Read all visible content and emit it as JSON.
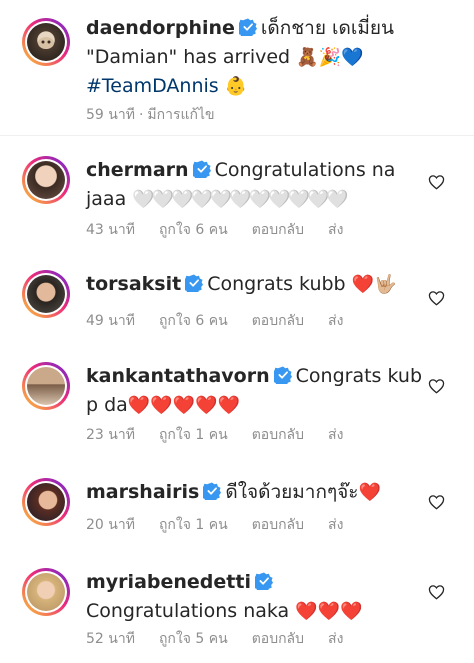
{
  "caption": {
    "username": "daendorphine",
    "text_line1": "เด็กชาย เดเมี่ยน",
    "text_line2": "\"Damian\" has arrived",
    "emoji_line2": "🧸🎉💙",
    "hashtag": "#TeamDAnnis",
    "emoji_line3": "👶",
    "time": "59 นาที",
    "separator": "·",
    "edited": "มีการแก้ไข"
  },
  "labels": {
    "reply": "ตอบกลับ",
    "send": "ส่ง"
  },
  "comments": [
    {
      "username": "chermarn",
      "text": "Congratulations na jaaa",
      "emoji": "🤍🤍🤍🤍🤍🤍🤍🤍🤍🤍🤍",
      "time": "43 นาที",
      "likes": "ถูกใจ 6 คน"
    },
    {
      "username": "torsaksit",
      "text": "Congrats kubb",
      "emoji": "❤️🤟🏼",
      "time": "49 นาที",
      "likes": "ถูกใจ 6 คน"
    },
    {
      "username": "kankantathavorn",
      "text": "Congrats kub p da",
      "emoji": "❤️❤️❤️❤️❤️",
      "time": "23 นาที",
      "likes": "ถูกใจ 1 คน"
    },
    {
      "username": "marshairis",
      "text": "ดีใจด้วยมากๆจ๊ะ",
      "emoji": "❤️",
      "time": "20 นาที",
      "likes": "ถูกใจ 1 คน"
    },
    {
      "username": "myriabenedetti",
      "text": "Congratulations naka",
      "emoji": "❤️❤️❤️",
      "time": "52 นาที",
      "likes": "ถูกใจ 5 คน"
    }
  ],
  "colors": {
    "verified": "#3897f0",
    "heart": "#e0245e",
    "meta": "#8e8e8e"
  }
}
